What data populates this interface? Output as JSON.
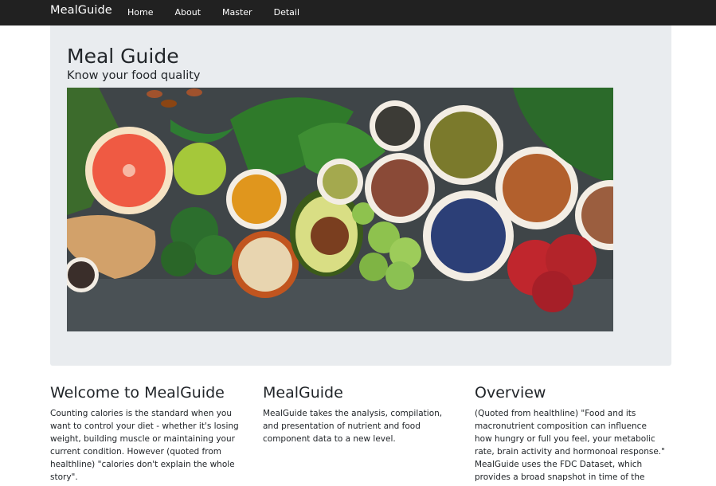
{
  "navbar": {
    "brand": "MealGuide",
    "links": [
      "Home",
      "About",
      "Master",
      "Detail"
    ]
  },
  "jumbotron": {
    "title": "Meal Guide",
    "lead": "Know your food quality"
  },
  "columns": [
    {
      "heading": "Welcome to MealGuide",
      "text": "Counting calories is the standard when you want to control your diet - whether it's losing weight, building muscle or maintaining your current condition. However (quoted from healthline) \"calories don't explain the whole story\"."
    },
    {
      "heading": "MealGuide",
      "text": "MealGuide takes the analysis, compilation, and presentation of nutrient and food component data to a new level."
    },
    {
      "heading": "Overview",
      "text": "(Quoted from healthline) \"Food and its macronutrient composition can influence how hungry or full you feel, your metabolic rate, brain activity and hormonoal response.\" MealGuide uses the FDC Dataset, which provides a broad snapshot in time of the"
    }
  ],
  "colors": {
    "navbar_bg": "#212121",
    "jumbotron_bg": "#e9ecef",
    "text": "#212529"
  }
}
